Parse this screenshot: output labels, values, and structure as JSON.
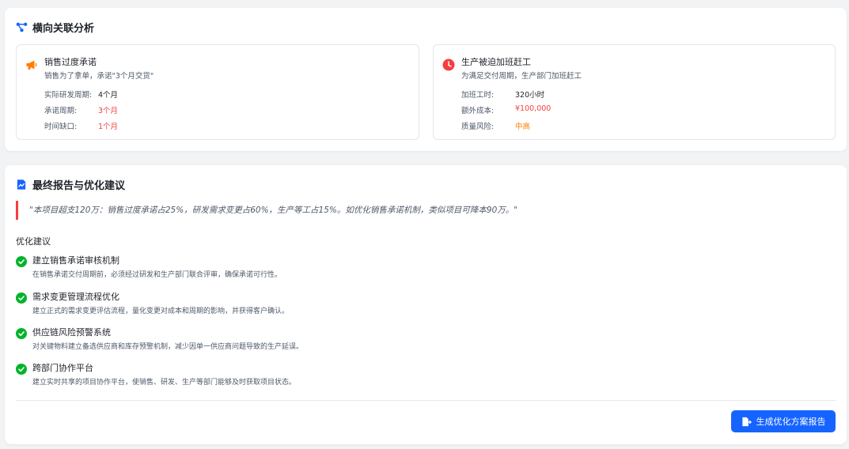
{
  "lateral": {
    "title": "横向关联分析",
    "left": {
      "title": "销售过度承诺",
      "subtitle": "销售为了拿单，承诺\"3个月交货\"",
      "rows": [
        {
          "k": "实际研发周期:",
          "v": "4个月"
        },
        {
          "k": "承诺周期:",
          "v": "3个月"
        },
        {
          "k": "时间缺口:",
          "v": "1个月"
        }
      ]
    },
    "right": {
      "title": "生产被迫加班赶工",
      "subtitle": "为满足交付周期，生产部门加班赶工",
      "rows": [
        {
          "k": "加班工时:",
          "v": "320小时"
        },
        {
          "k": "额外成本:",
          "v": "¥100,000"
        },
        {
          "k": "质量风险:",
          "v": "中高"
        }
      ]
    }
  },
  "report": {
    "title": "最终报告与优化建议",
    "quote": "\"本项目超支120万：销售过度承诺占25%，研发需求变更占60%，生产等工占15%。如优化销售承诺机制，类似项目可降本90万。\"",
    "suggestions_label": "优化建议",
    "suggestions": [
      {
        "title": "建立销售承诺审核机制",
        "desc": "在销售承诺交付周期前，必须经过研发和生产部门联合评审，确保承诺可行性。"
      },
      {
        "title": "需求变更管理流程优化",
        "desc": "建立正式的需求变更评估流程，量化变更对成本和周期的影响，并获得客户确认。"
      },
      {
        "title": "供应链风险预警系统",
        "desc": "对关键物料建立备选供应商和库存预警机制，减少因单一供应商问题导致的生产延误。"
      },
      {
        "title": "跨部门协作平台",
        "desc": "建立实时共享的项目协作平台，使销售、研发、生产等部门能够及时获取项目状态。"
      }
    ],
    "button_label": "生成优化方案报告"
  },
  "colors": {
    "accent": "#1664ff",
    "red": "#f53f3f",
    "orange": "#ff7d00",
    "green": "#00b42a"
  }
}
